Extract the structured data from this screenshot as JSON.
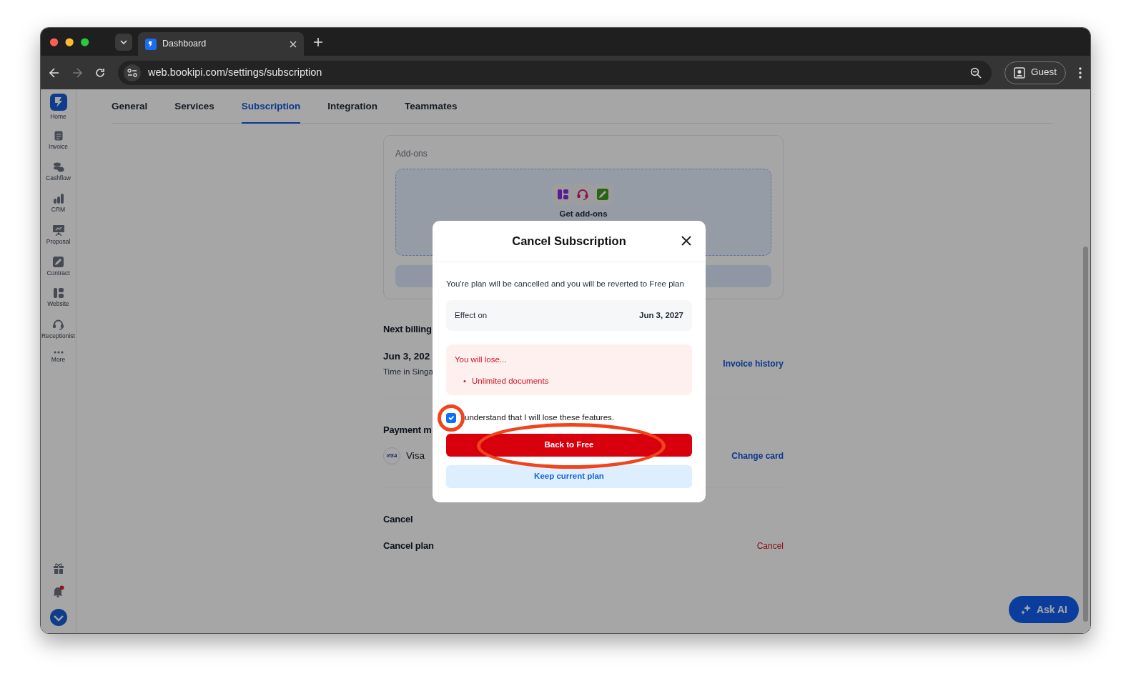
{
  "browser": {
    "tab_title": "Dashboard",
    "url": "web.bookipi.com/settings/subscription",
    "profile": "Guest"
  },
  "sidebar": {
    "items": [
      {
        "label": "Home"
      },
      {
        "label": "Invoice"
      },
      {
        "label": "Cashflow"
      },
      {
        "label": "CRM"
      },
      {
        "label": "Proposal"
      },
      {
        "label": "Contract"
      },
      {
        "label": "Website"
      },
      {
        "label": "Receptionist"
      },
      {
        "label": "More"
      }
    ]
  },
  "settings_tabs": [
    {
      "label": "General",
      "selected": false
    },
    {
      "label": "Services",
      "selected": false
    },
    {
      "label": "Subscription",
      "selected": true
    },
    {
      "label": "Integration",
      "selected": false
    },
    {
      "label": "Teammates",
      "selected": false
    }
  ],
  "addons": {
    "title": "Add-ons",
    "cta": "Get add-ons"
  },
  "next_billing": {
    "heading": "Next billing",
    "date": "Jun 3, 202",
    "note": "Time in Singa",
    "link": "Invoice history"
  },
  "payment": {
    "heading": "Payment m",
    "card_logo": "VISA",
    "card": "Visa",
    "link": "Change card"
  },
  "cancel": {
    "heading": "Cancel",
    "label": "Cancel plan",
    "link": "Cancel"
  },
  "modal": {
    "title": "Cancel Subscription",
    "message": "You're plan will be cancelled and you will be reverted to Free plan",
    "effect_label": "Effect on",
    "effect_date": "Jun 3, 2027",
    "lose_title": "You will lose...",
    "lose_items": [
      {
        "marker": "•",
        "text": "Unlimited documents"
      }
    ],
    "confirm": {
      "label": "understand that I will lose these features.",
      "checked": true,
      "highlighted": true
    },
    "primary_button": {
      "label": "Back to Free",
      "highlighted": true
    },
    "secondary_button": "Keep current plan"
  },
  "ask_ai": "Ask AI"
}
